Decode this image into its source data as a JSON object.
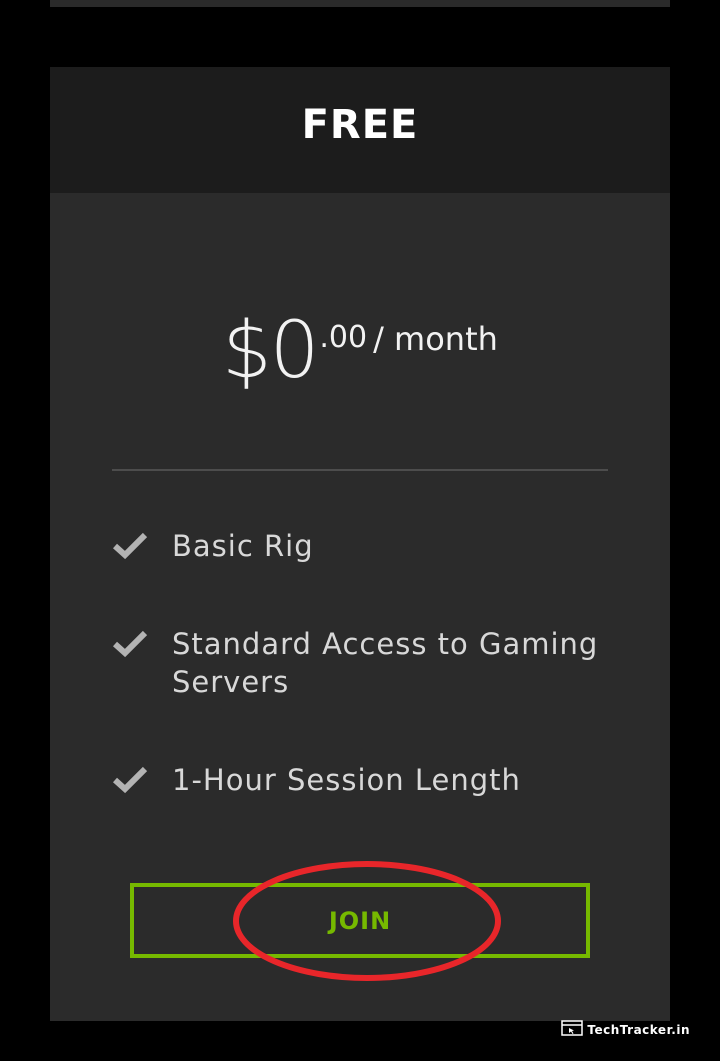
{
  "plan": {
    "title": "FREE",
    "price": {
      "currency": "$",
      "amount": "0",
      "cents": ".00",
      "period": "/ month"
    },
    "features": [
      {
        "icon": "check-icon",
        "text": "Basic Rig"
      },
      {
        "icon": "check-icon",
        "text": "Standard Access to Gaming Servers"
      },
      {
        "icon": "check-icon",
        "text": "1-Hour Session Length"
      }
    ],
    "join_label": "JOIN"
  },
  "watermark": {
    "icon": "browser-window-icon",
    "text": "TechTracker.in"
  },
  "colors": {
    "background": "#000000",
    "card": "#2b2b2b",
    "card_header": "#1c1c1c",
    "accent": "#76b900",
    "annotation": "#e8262a",
    "check": "#b3b3b3"
  }
}
